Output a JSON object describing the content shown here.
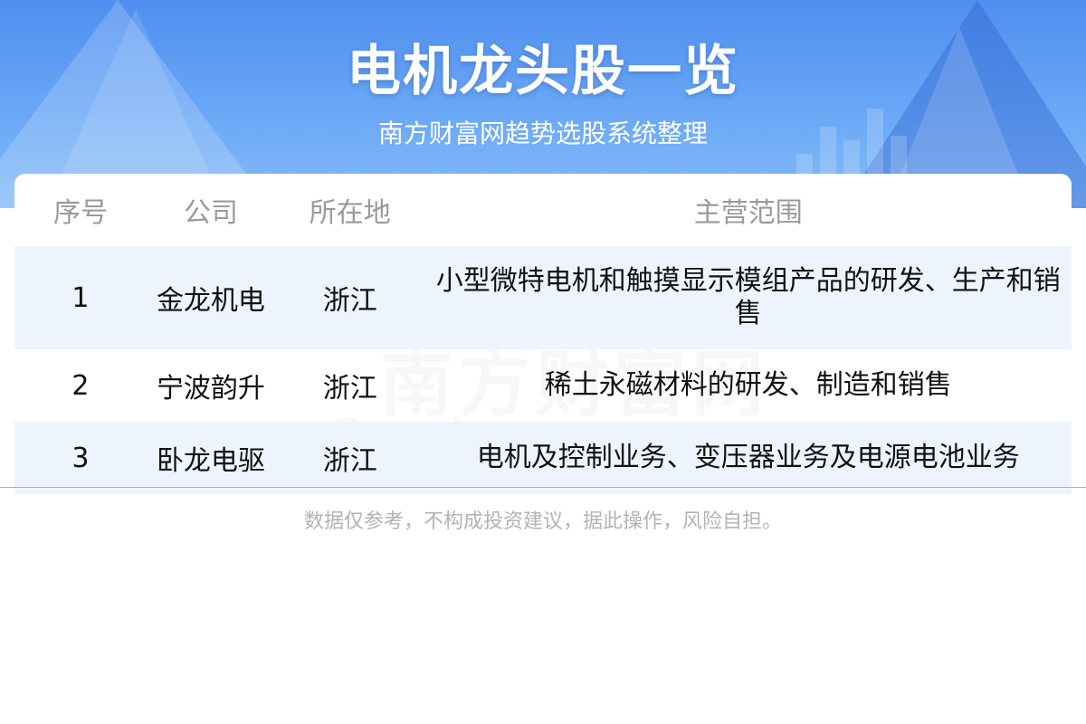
{
  "header": {
    "title": "电机龙头股一览",
    "subtitle": "南方财富网趋势选股系统整理"
  },
  "table": {
    "columns": [
      "序号",
      "公司",
      "所在地",
      "主营范围"
    ],
    "rows": [
      {
        "index": "1",
        "company": "金龙机电",
        "location": "浙江",
        "business": "小型微特电机和触摸显示模组产品的研发、生产和销售"
      },
      {
        "index": "2",
        "company": "宁波韵升",
        "location": "浙江",
        "business": "稀土永磁材料的研发、制造和销售"
      },
      {
        "index": "3",
        "company": "卧龙电驱",
        "location": "浙江",
        "business": "电机及控制业务、变压器业务及电源电池业务"
      }
    ]
  },
  "watermark": {
    "cn": "南方财富网",
    "en": "Southmoney.com"
  },
  "footer": {
    "disclaimer": "数据仅参考，不构成投资建议，据此操作，风险自担。"
  },
  "colors": {
    "header_blue": "#4f8ff0",
    "row_tint": "#eef4fe",
    "header_text": "#9a9a9a"
  }
}
